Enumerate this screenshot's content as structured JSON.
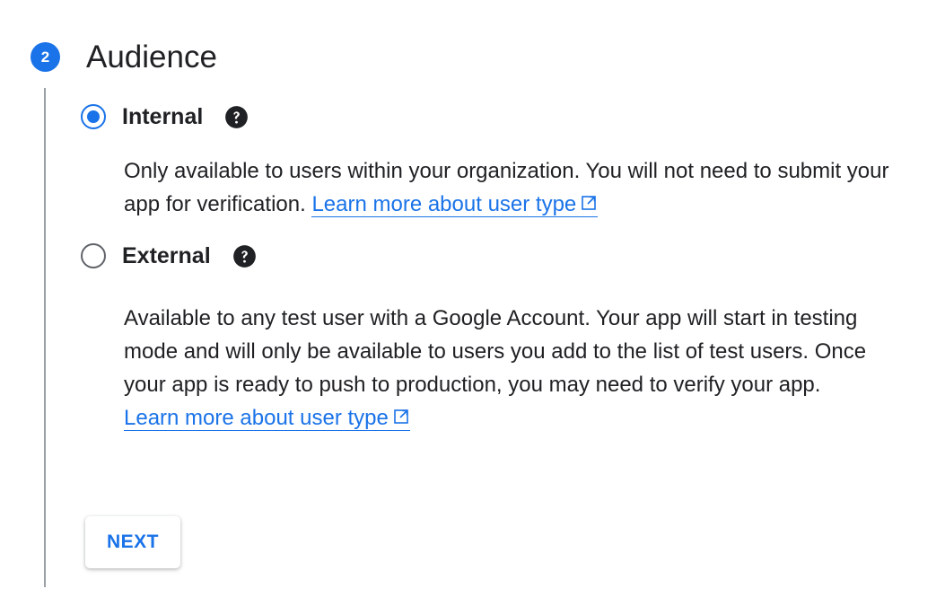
{
  "step": {
    "number": "2",
    "title": "Audience"
  },
  "options": [
    {
      "label": "Internal",
      "checked": true,
      "help_icon": "help-circle-icon",
      "description": "Only available to users within your organization. You will not need to submit your app for verification.",
      "link_text": "Learn more about user type",
      "link_icon": "open-in-new-icon"
    },
    {
      "label": "External",
      "checked": false,
      "help_icon": "help-circle-icon",
      "description": "Available to any test user with a Google Account. Your app will start in testing mode and will only be available to users you add to the list of test users. Once your app is ready to push to production, you may need to verify your app.",
      "link_text": "Learn more about user type",
      "link_icon": "open-in-new-icon"
    }
  ],
  "actions": {
    "next_label": "NEXT"
  },
  "colors": {
    "accent": "#1a73e8",
    "text": "#202124",
    "radio_unchecked": "#5f6368",
    "step_line": "#9aa0a6"
  }
}
